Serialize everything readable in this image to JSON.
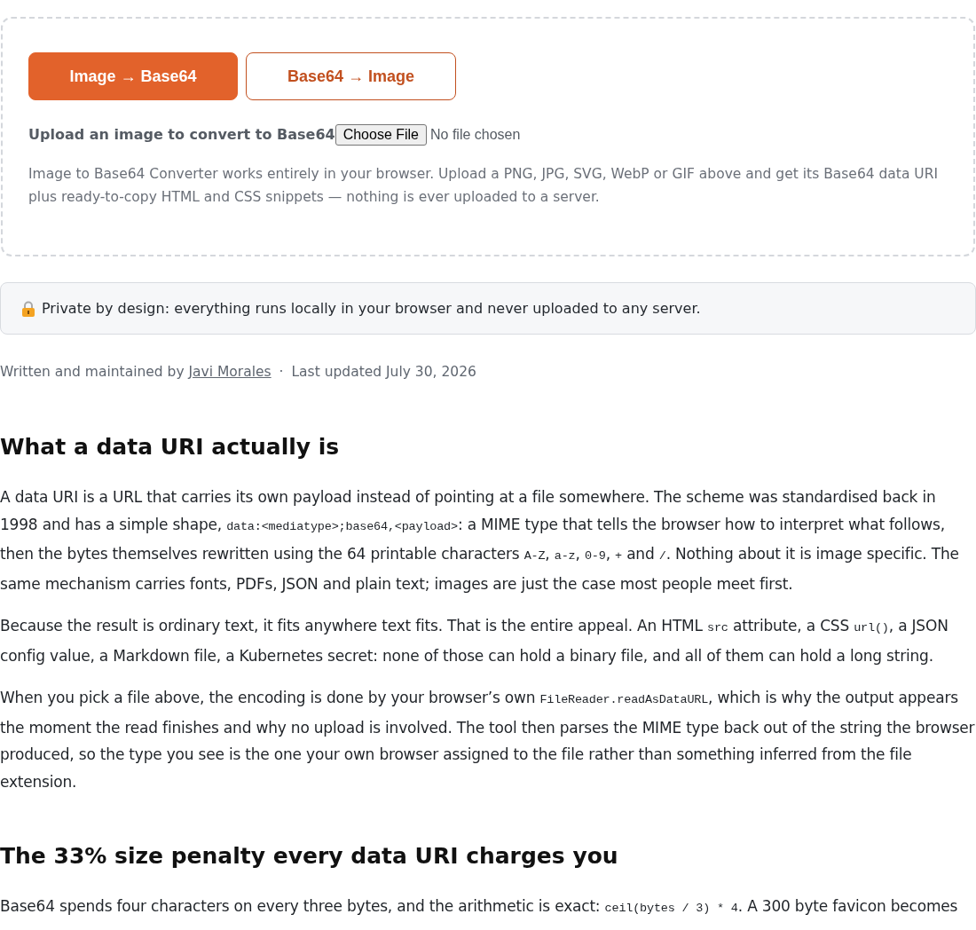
{
  "tool": {
    "tabs": [
      {
        "label": "Image → Base64",
        "selected": true
      },
      {
        "label": "Base64 → Image",
        "selected": false
      }
    ],
    "upload": {
      "label": "Upload an image to convert to Base64",
      "button": "Choose File",
      "status": "No file chosen"
    },
    "description": "Image to Base64 Converter works entirely in your browser. Upload a PNG, JPG, SVG, WebP or GIF above and get its Base64 data URI plus ready-to-copy HTML and CSS snippets — nothing is ever uploaded to a server."
  },
  "privacy_notice": "Private by design: everything runs locally in your browser and never uploaded to any server.",
  "byline": {
    "prefix": "Written and maintained by",
    "author": "Javi Morales",
    "separator": "·",
    "updated": "Last updated July 30, 2026"
  },
  "sections": [
    {
      "heading": "What a data URI actually is",
      "paragraphs": [
        [
          {
            "kind": "text",
            "text": "A data URI is a URL that carries its own payload instead of pointing at a file somewhere. The scheme was standardised back in 1998 and has a simple shape, "
          },
          {
            "kind": "code",
            "text": "data:<mediatype>;base64,<payload>"
          },
          {
            "kind": "text",
            "text": ": a MIME type that tells the browser how to interpret what follows, then the bytes themselves rewritten using the 64 printable characters "
          },
          {
            "kind": "code",
            "text": "A-Z"
          },
          {
            "kind": "text",
            "text": ", "
          },
          {
            "kind": "code",
            "text": "a-z"
          },
          {
            "kind": "text",
            "text": ", "
          },
          {
            "kind": "code",
            "text": "0-9"
          },
          {
            "kind": "text",
            "text": ", "
          },
          {
            "kind": "code",
            "text": "+"
          },
          {
            "kind": "text",
            "text": " and "
          },
          {
            "kind": "code",
            "text": "/"
          },
          {
            "kind": "text",
            "text": ". Nothing about it is image specific. The same mechanism carries fonts, PDFs, JSON and plain text; images are just the case most people meet first."
          }
        ],
        [
          {
            "kind": "text",
            "text": "Because the result is ordinary text, it fits anywhere text fits. That is the entire appeal. An HTML "
          },
          {
            "kind": "code",
            "text": "src"
          },
          {
            "kind": "text",
            "text": " attribute, a CSS "
          },
          {
            "kind": "code",
            "text": "url()"
          },
          {
            "kind": "text",
            "text": ", a JSON config value, a Markdown file, a Kubernetes secret: none of those can hold a binary file, and all of them can hold a long string."
          }
        ],
        [
          {
            "kind": "text",
            "text": "When you pick a file above, the encoding is done by your browser’s own "
          },
          {
            "kind": "code",
            "text": "FileReader.readAsDataURL"
          },
          {
            "kind": "text",
            "text": ", which is why the output appears the moment the read finishes and why no upload is involved. The tool then parses the MIME type back out of the string the browser produced, so the type you see is the one your own browser assigned to the file rather than something inferred from the file extension."
          }
        ]
      ]
    },
    {
      "heading": "The 33% size penalty every data URI charges you",
      "paragraphs": [
        [
          {
            "kind": "text",
            "text": "Base64 spends four characters on every three bytes, and the arithmetic is exact: "
          },
          {
            "kind": "code",
            "text": "ceil(bytes / 3) * 4"
          },
          {
            "kind": "text",
            "text": ". A 300 byte favicon becomes"
          }
        ]
      ]
    }
  ]
}
